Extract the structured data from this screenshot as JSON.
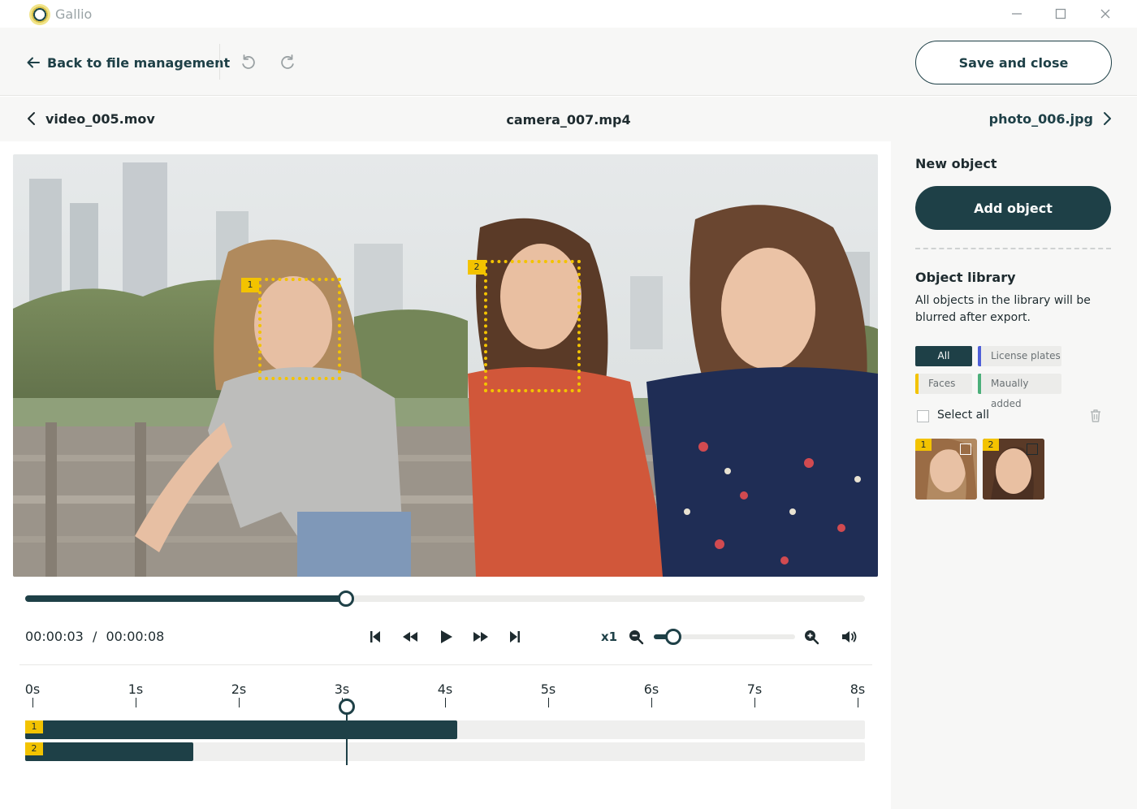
{
  "app": {
    "name": "Gallio",
    "logo_icon": "gallio-ring-logo"
  },
  "window_controls": [
    "minimize-icon",
    "maximize-icon",
    "close-icon"
  ],
  "toolbar": {
    "back_label": "Back to file management",
    "undo_icon": "undo-icon",
    "redo_icon": "redo-icon",
    "save_label": "Save and close"
  },
  "file_nav": {
    "prev": "video_005.mov",
    "current": "camera_007.mp4",
    "next": "photo_006.jpg"
  },
  "video": {
    "detections": [
      {
        "id": "1",
        "type": "face"
      },
      {
        "id": "2",
        "type": "face"
      }
    ]
  },
  "player": {
    "current_time": "00:00:03",
    "separator": "/",
    "total_time": "00:00:08",
    "progress": 0.382,
    "buttons": [
      "skip-start-icon",
      "rewind-icon",
      "play-icon",
      "fast-forward-icon",
      "skip-end-icon"
    ],
    "speed": "x1",
    "zoom_level": 0.08,
    "volume_icon": "volume-icon"
  },
  "timeline": {
    "ticks": [
      "0s",
      "1s",
      "2s",
      "3s",
      "4s",
      "5s",
      "6s",
      "7s",
      "8s"
    ],
    "playhead_seconds": 3.05,
    "tracks": [
      {
        "id": "1",
        "end_seconds": 4.12
      },
      {
        "id": "2",
        "end_seconds": 1.56
      }
    ]
  },
  "sidebar": {
    "new_object_title": "New object",
    "add_object_label": "Add object",
    "library_title": "Object library",
    "library_desc": "All objects in the library will be blurred after export.",
    "filters": [
      {
        "label": "All",
        "active": true,
        "color": "#1e4047"
      },
      {
        "label": "License plates",
        "active": false,
        "color": "#4f5fd8"
      },
      {
        "label": "Faces",
        "active": false,
        "color": "#f3c300"
      },
      {
        "label": "Maually added",
        "active": false,
        "color": "#4caf7a"
      }
    ],
    "select_all_label": "Select all",
    "trash_icon": "trash-icon",
    "thumbnails": [
      {
        "id": "1"
      },
      {
        "id": "2"
      }
    ]
  },
  "colors": {
    "primary": "#1e4047",
    "detection": "#f3c300",
    "panel": "#f7f7f6"
  }
}
